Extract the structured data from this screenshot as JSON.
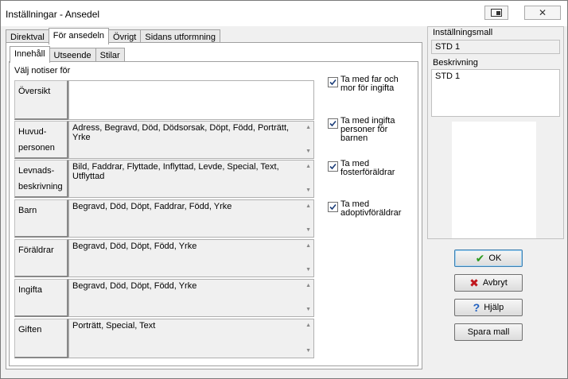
{
  "window": {
    "title": "Inställningar - Ansedel",
    "close_symbol": "✕"
  },
  "outer_tabs": [
    "Direktval",
    "För ansedeln",
    "Övrigt",
    "Sidans utformning"
  ],
  "inner_tabs": [
    "Innehåll",
    "Utseende",
    "Stilar"
  ],
  "section_label": "Välj notiser för",
  "rows": [
    {
      "label": "Översikt",
      "value": ""
    },
    {
      "label": "Huvud-\npersonen",
      "value": "Adress, Begravd, Död, Dödsorsak, Döpt, Född, Porträtt, Yrke"
    },
    {
      "label": "Levnads-\nbeskrivning",
      "value": "Bild, Faddrar, Flyttade, Inflyttad, Levde, Special, Text, Utflyttad"
    },
    {
      "label": "Barn",
      "value": "Begravd, Död, Döpt, Faddrar, Född, Yrke"
    },
    {
      "label": "Föräldrar",
      "value": "Begravd, Död, Döpt, Född, Yrke"
    },
    {
      "label": "Ingifta",
      "value": "Begravd, Död, Döpt, Född, Yrke"
    },
    {
      "label": "Giften",
      "value": "Porträtt, Special, Text"
    }
  ],
  "checkboxes": [
    {
      "label": "Ta med far och mor för ingifta",
      "checked": true
    },
    {
      "label": "Ta med ingifta personer för barnen",
      "checked": true
    },
    {
      "label": "Ta med fosterföräldrar",
      "checked": true
    },
    {
      "label": "Ta med adoptivföräldrar",
      "checked": true
    }
  ],
  "right_pane": {
    "template_label": "Inställningsmall",
    "template_value": "STD 1",
    "description_label": "Beskrivning",
    "description_value": "STD 1"
  },
  "buttons": {
    "ok": "OK",
    "cancel": "Avbryt",
    "help": "Hjälp",
    "save_template": "Spara mall"
  },
  "colors": {
    "ok_icon": "#2a9a1f",
    "cancel_icon": "#c0171e",
    "help_icon": "#1f5fbf"
  }
}
